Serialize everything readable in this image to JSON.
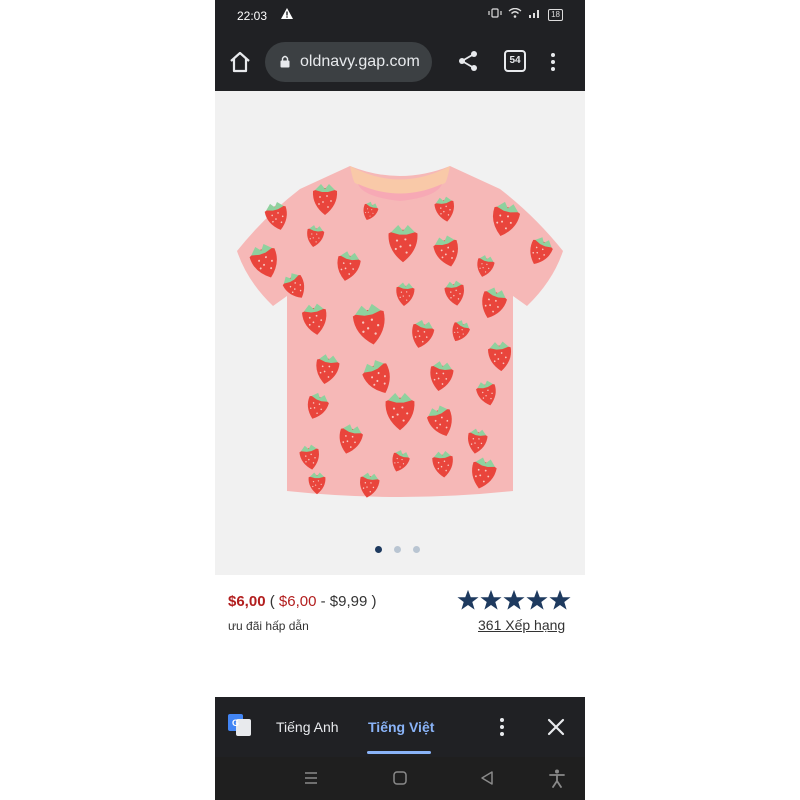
{
  "status_bar": {
    "time": "22:03",
    "battery": "18",
    "icons": [
      "alert-icon",
      "vibrate-icon",
      "wifi-icon",
      "signal-icon",
      "battery-icon"
    ]
  },
  "browser": {
    "url": "oldnavy.gap.com",
    "tab_count": "54",
    "icons": [
      "home-icon",
      "lock-icon",
      "share-icon",
      "tabs-icon",
      "more-icon"
    ]
  },
  "product": {
    "image_description_icon": "strawberry-tshirt-image",
    "carousel": {
      "count": 3,
      "active_index": 0
    },
    "price": "$6,00",
    "price_open": "(",
    "range_low": "$6,00",
    "range_sep": " - ",
    "range_high": "$9,99",
    "price_close": ")",
    "promo": "ưu đãi hấp dẫn",
    "rating": {
      "value": 5,
      "max": 5,
      "star_color": "#1e3a5f"
    },
    "ratings_link": "361 Xếp hạng"
  },
  "translate_bar": {
    "source_language": "Tiếng Anh",
    "target_language": "Tiếng Việt",
    "active": "target",
    "accent": "#8ab4f8"
  },
  "nav_bar": {
    "icons": [
      "recent-apps-icon",
      "home-nav-icon",
      "back-icon",
      "accessibility-icon"
    ]
  },
  "colors": {
    "price_red": "#b21e1e",
    "shirt_pink": "#f6b8b7",
    "strawberry_red": "#e9453c",
    "chrome_dark": "#202124"
  }
}
